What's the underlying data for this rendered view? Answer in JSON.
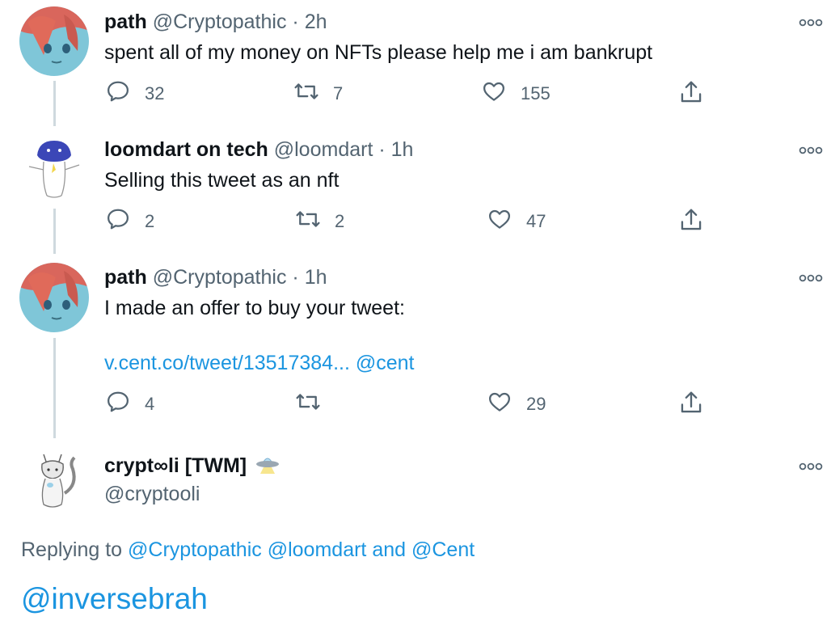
{
  "tweets": [
    {
      "name": "path",
      "handle": "@Cryptopathic",
      "separator": "·",
      "time": "2h",
      "text": "spent all of my money on NFTs please help me i am bankrupt",
      "replies": "32",
      "retweets": "7",
      "likes": "155",
      "avatar_icon": "anime-girl-avatar"
    },
    {
      "name": "loomdart on tech",
      "handle": "@loomdart",
      "separator": "·",
      "time": "1h",
      "text": "Selling this tweet as an nft",
      "replies": "2",
      "retweets": "2",
      "likes": "47",
      "avatar_icon": "doodle-creature-avatar"
    },
    {
      "name": "path",
      "handle": "@Cryptopathic",
      "separator": "·",
      "time": "1h",
      "text": "I made an offer to buy your tweet:",
      "link_text": "v.cent.co/tweet/13517384...",
      "link_mention": "@cent",
      "replies": "4",
      "retweets": "",
      "likes": "29",
      "avatar_icon": "anime-girl-avatar"
    }
  ],
  "compose": {
    "name": "crypt∞li [TWM]",
    "name_emoji": "ufo-icon",
    "handle": "@cryptooli",
    "replying_prefix": "Replying to",
    "replying_mention_1": "@Cryptopathic",
    "replying_mention_2": "@loomdart",
    "replying_and": "and",
    "replying_mention_3": "@Cent",
    "draft_text": "@inversebrah",
    "avatar_icon": "cat-sketch-avatar"
  },
  "colors": {
    "link": "#1b95e0",
    "muted": "#536471",
    "text": "#0f1419",
    "thread_line": "#cfd9de"
  }
}
